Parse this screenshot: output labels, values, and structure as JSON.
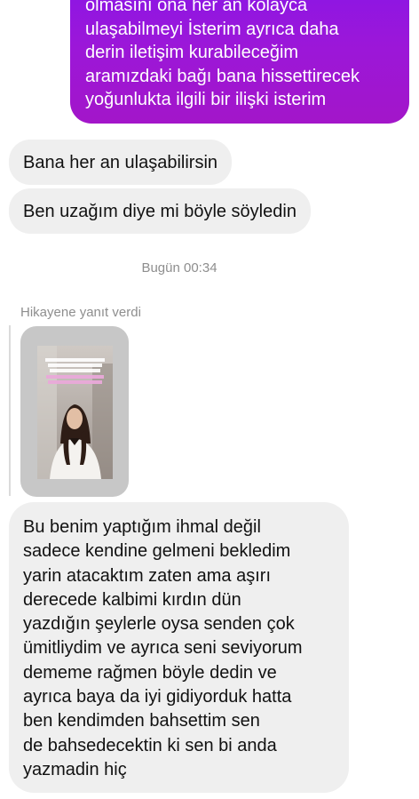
{
  "conversation": {
    "sent_message": "olmasını ona her an kolayca\nulaşabilmeyi İsterim ayrıca daha\nderin iletişim kurabileceğim\naramızdaki bağı  bana hissettirecek\nyoğunlukta ilgili bir ilişki isterim",
    "received_messages": [
      "Bana her an ulaşabilirsin",
      "Ben uzağım diye mi böyle söyledin"
    ],
    "timestamp": "Bugün 00:34",
    "story_reply_label": "Hikayene yanıt verdi",
    "long_message": "Bu benim yaptığım ihmal değil\nsadece kendine gelmeni bekledim\nyarin atacaktım zaten ama aşırı\nderecede kalbimi kırdın dün\nyazdığın şeylerle oysa senden çok\nümitliydim ve ayrıca seni seviyorum\ndememe rağmen böyle dedin ve\nayrıca baya da iyi gidiyorduk hatta\nben kendimden bahsettim sen\nde bahsedecektin ki sen bi anda\nyazmadin hiç"
  },
  "colors": {
    "sent_bubble_top": "#8a16e6",
    "sent_bubble_bottom": "#a316c9",
    "received_bubble": "#efefef",
    "meta_text": "#8e8e8e"
  }
}
